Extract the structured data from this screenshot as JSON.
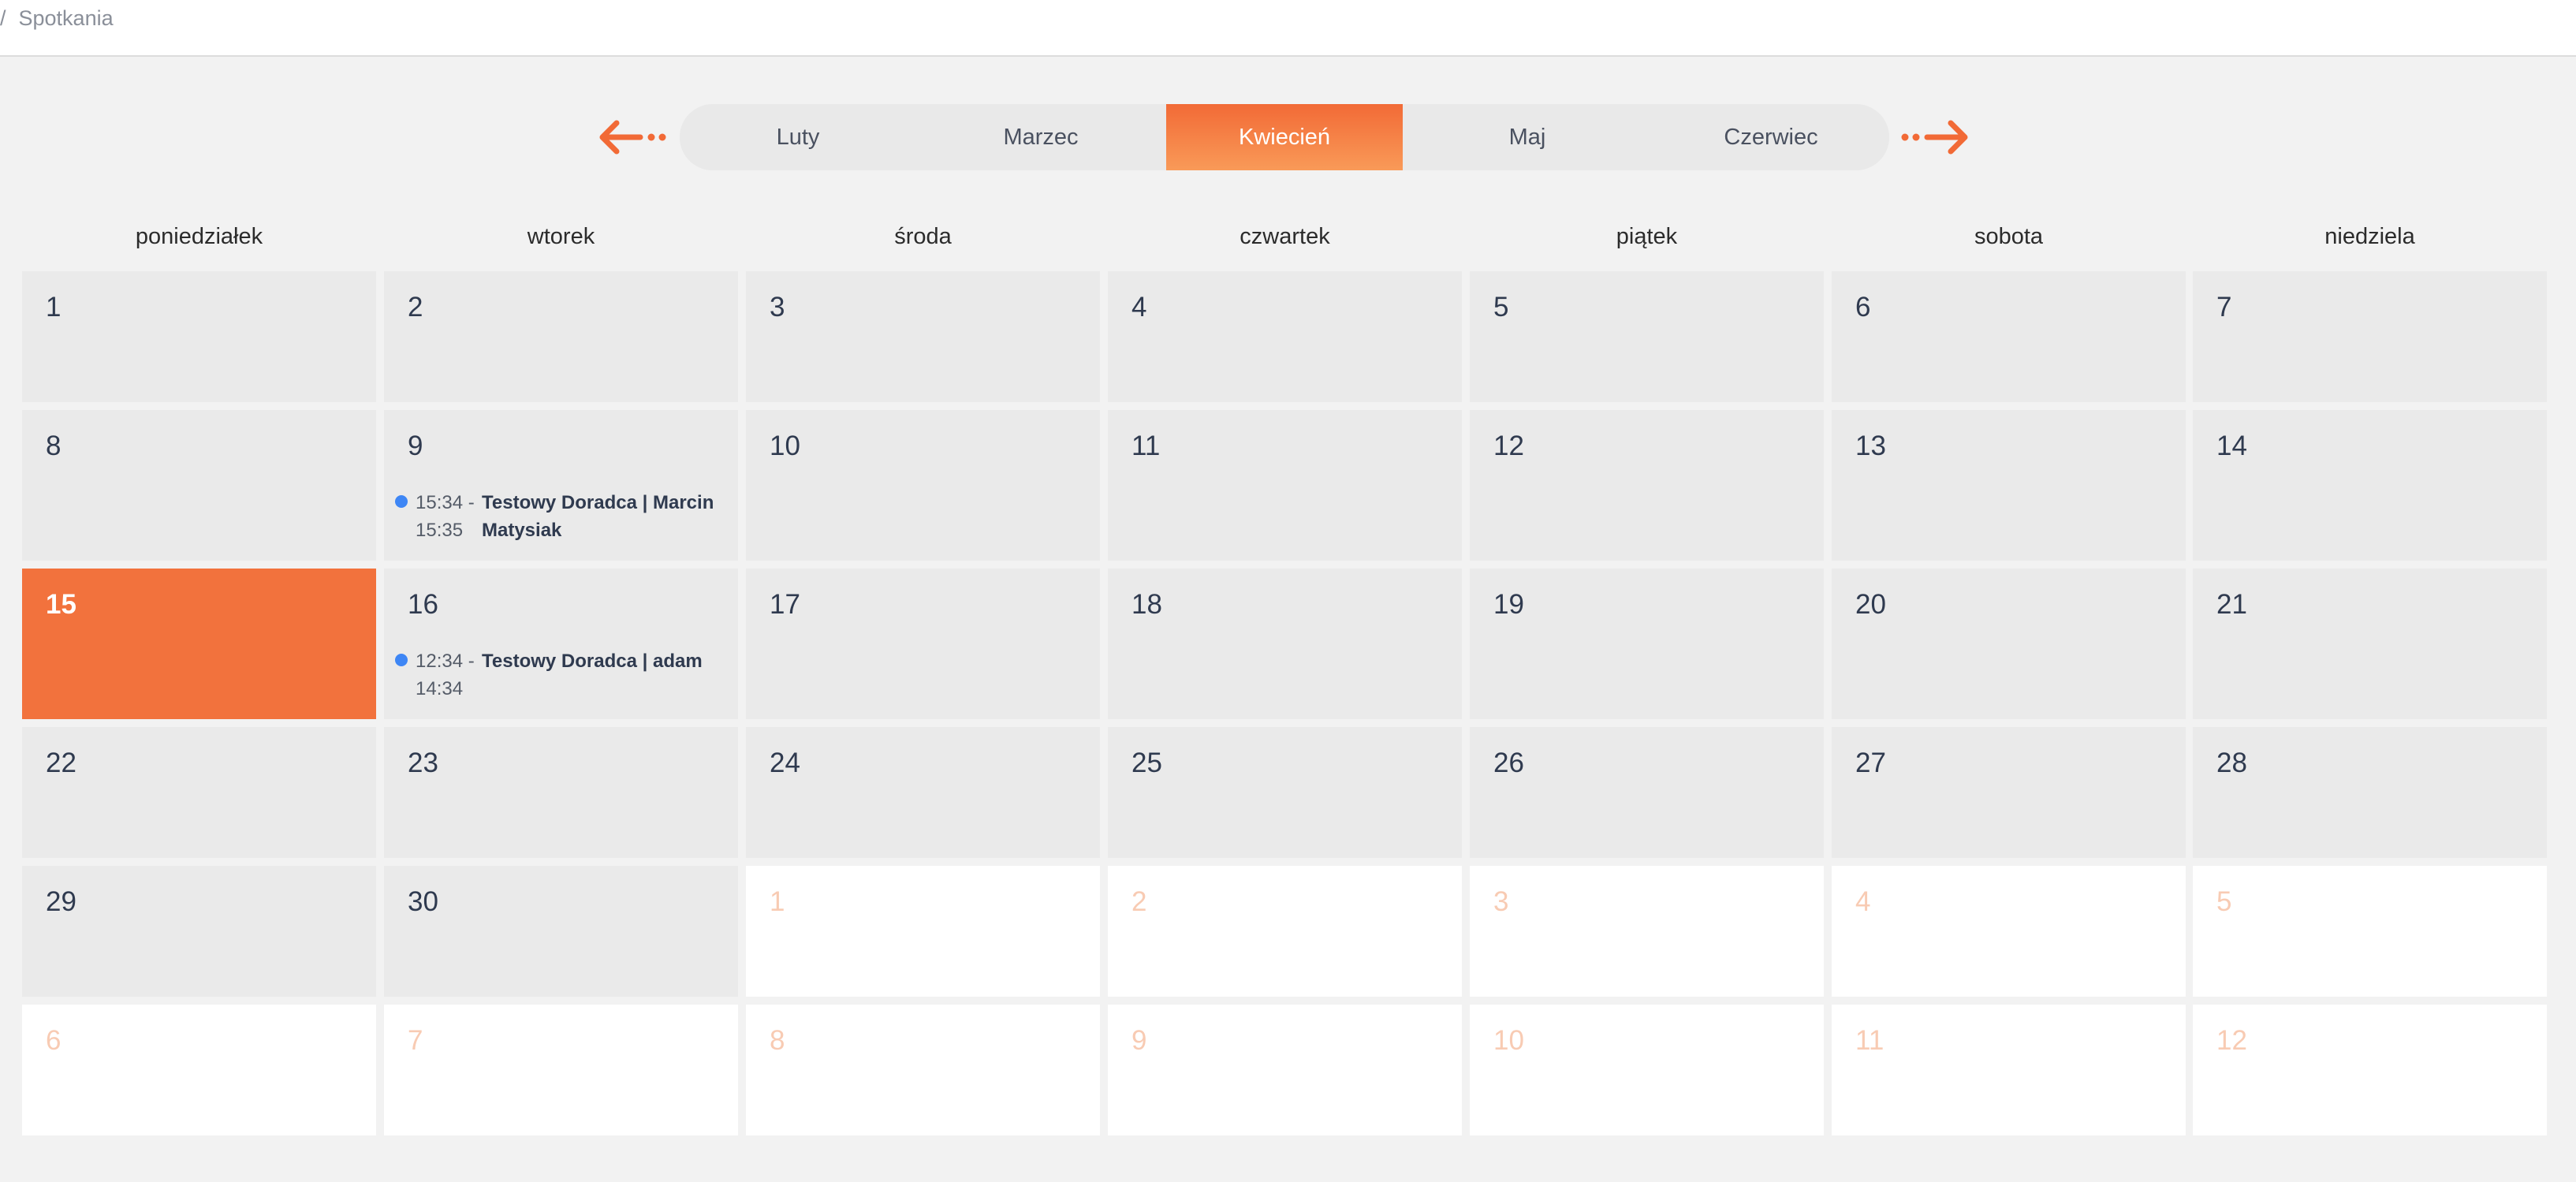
{
  "breadcrumb": {
    "separator": "/",
    "current": "Spotkania"
  },
  "month_nav": {
    "prev_icon": "arrow-left-icon",
    "next_icon": "arrow-right-icon",
    "accent_color": "#f26a36",
    "months": [
      "Luty",
      "Marzec",
      "Kwiecień",
      "Maj",
      "Czerwiec"
    ],
    "active_month": "Kwiecień"
  },
  "weekdays": [
    "poniedziałek",
    "wtorek",
    "środa",
    "czwartek",
    "piątek",
    "sobota",
    "niedziela"
  ],
  "weeks": [
    [
      {
        "day": "1"
      },
      {
        "day": "2"
      },
      {
        "day": "3"
      },
      {
        "day": "4"
      },
      {
        "day": "5"
      },
      {
        "day": "6"
      },
      {
        "day": "7"
      }
    ],
    [
      {
        "day": "8"
      },
      {
        "day": "9",
        "events": [
          {
            "start": "15:34 -",
            "end": "15:35",
            "title": "Testowy Doradca | Marcin Matysiak"
          }
        ]
      },
      {
        "day": "10"
      },
      {
        "day": "11"
      },
      {
        "day": "12"
      },
      {
        "day": "13"
      },
      {
        "day": "14"
      }
    ],
    [
      {
        "day": "15",
        "today": true
      },
      {
        "day": "16",
        "events": [
          {
            "start": "12:34 -",
            "end": "14:34",
            "title": "Testowy Doradca | adam"
          }
        ]
      },
      {
        "day": "17"
      },
      {
        "day": "18"
      },
      {
        "day": "19"
      },
      {
        "day": "20"
      },
      {
        "day": "21"
      }
    ],
    [
      {
        "day": "22"
      },
      {
        "day": "23"
      },
      {
        "day": "24"
      },
      {
        "day": "25"
      },
      {
        "day": "26"
      },
      {
        "day": "27"
      },
      {
        "day": "28"
      }
    ],
    [
      {
        "day": "29"
      },
      {
        "day": "30"
      },
      {
        "day": "1",
        "other_month": true
      },
      {
        "day": "2",
        "other_month": true
      },
      {
        "day": "3",
        "other_month": true
      },
      {
        "day": "4",
        "other_month": true
      },
      {
        "day": "5",
        "other_month": true
      }
    ],
    [
      {
        "day": "6",
        "other_month": true
      },
      {
        "day": "7",
        "other_month": true
      },
      {
        "day": "8",
        "other_month": true
      },
      {
        "day": "9",
        "other_month": true
      },
      {
        "day": "10",
        "other_month": true
      },
      {
        "day": "11",
        "other_month": true
      },
      {
        "day": "12",
        "other_month": true
      }
    ]
  ]
}
